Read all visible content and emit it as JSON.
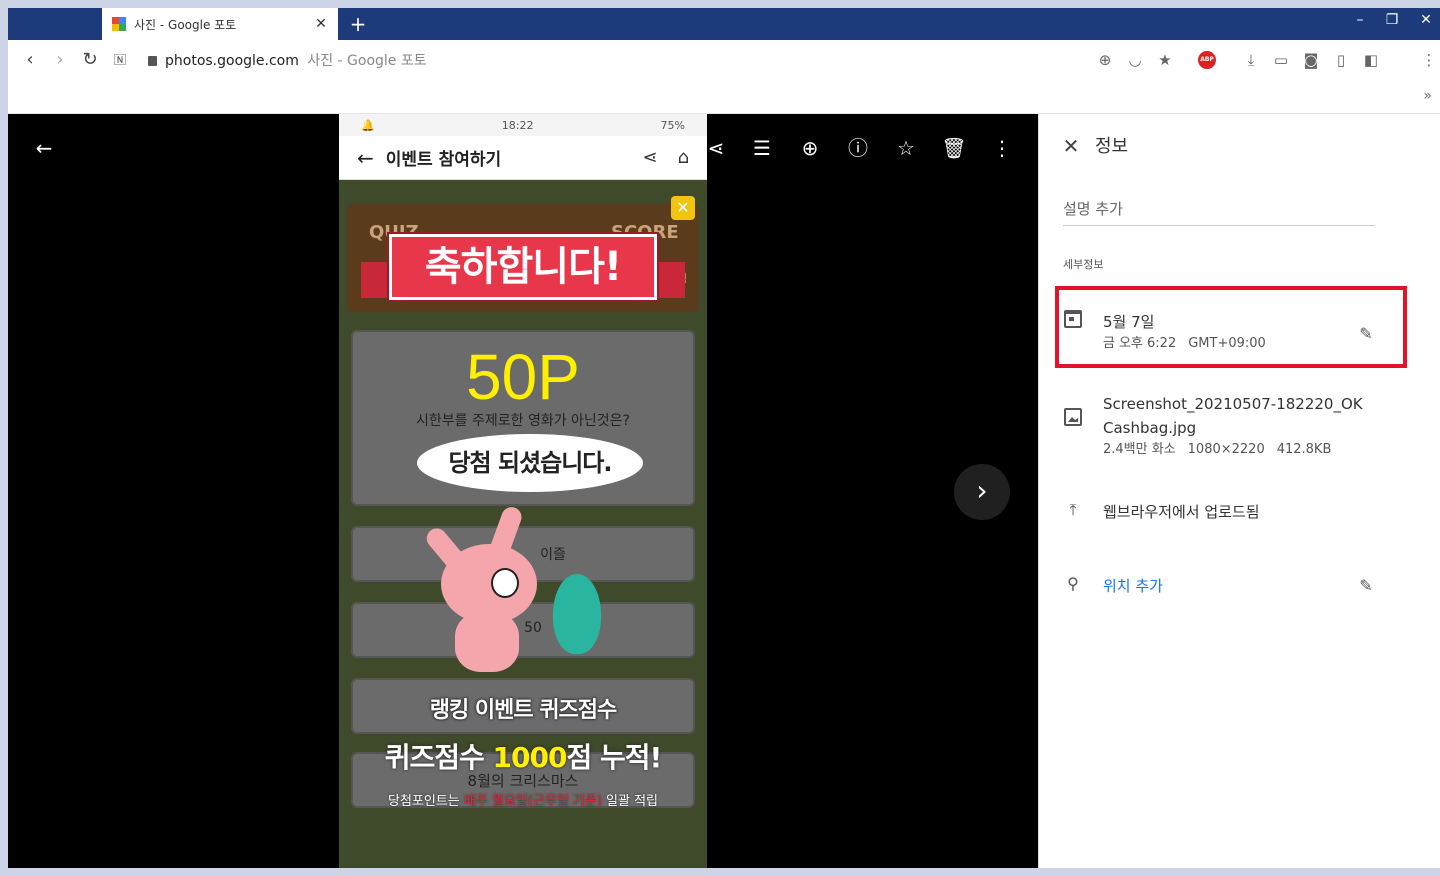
{
  "browser": {
    "tab_title": "사진 - Google 포토",
    "tab_close": "✕",
    "new_tab": "+",
    "url": "photos.google.com",
    "page_title": "사진 - Google 포토",
    "bookmarks_more": "»"
  },
  "viewer": {
    "back_icon": "←",
    "toolbar_icons": [
      "share-icon",
      "tune-icon",
      "zoom-icon",
      "info-icon",
      "star-icon",
      "trash-icon",
      "more-icon"
    ],
    "next_icon": "›"
  },
  "phone": {
    "time": "18:22",
    "battery": "75%",
    "app_title": "이벤트 참여하기",
    "quiz_label": "QUIZ",
    "score_label": "SCORE",
    "score_unit": "점",
    "congrats": "축하합니다!",
    "points": "50P",
    "question": "시한부를 주제로한 영화가 아닌것은?",
    "won_bubble": "당첨 되셨습니다.",
    "option1_partial": "이즐",
    "option2_partial": "50",
    "ranking_text": "랭킹 이벤트 퀴즈점수",
    "quiz_score_prefix": "퀴즈점수 ",
    "quiz_score_value": "1000",
    "quiz_score_suffix": "점 누적!",
    "xmas_text": "8월의 크리스마스",
    "footnote_prefix": "당첨포인트는 ",
    "footnote_red": "매주 월요일(근무일 기준)",
    "footnote_suffix": " 일괄 적립"
  },
  "info": {
    "close_icon": "✕",
    "heading": "정보",
    "description_placeholder": "설명 추가",
    "section_label": "세부정보",
    "date": "5월 7일",
    "date_day": "금",
    "date_time": "오후 6:22",
    "date_tz": "GMT+09:00",
    "file_name_line1": "Screenshot_20210507-182220_OK",
    "file_name_line2": "Cashbag.jpg",
    "file_pixels": "2.4백만 화소",
    "file_dims": "1080×2220",
    "file_size": "412.8KB",
    "upload_source": "웹브라우저에서 업로드됨",
    "location_link": "위치 추가",
    "highlight_color": "#e3142a"
  }
}
